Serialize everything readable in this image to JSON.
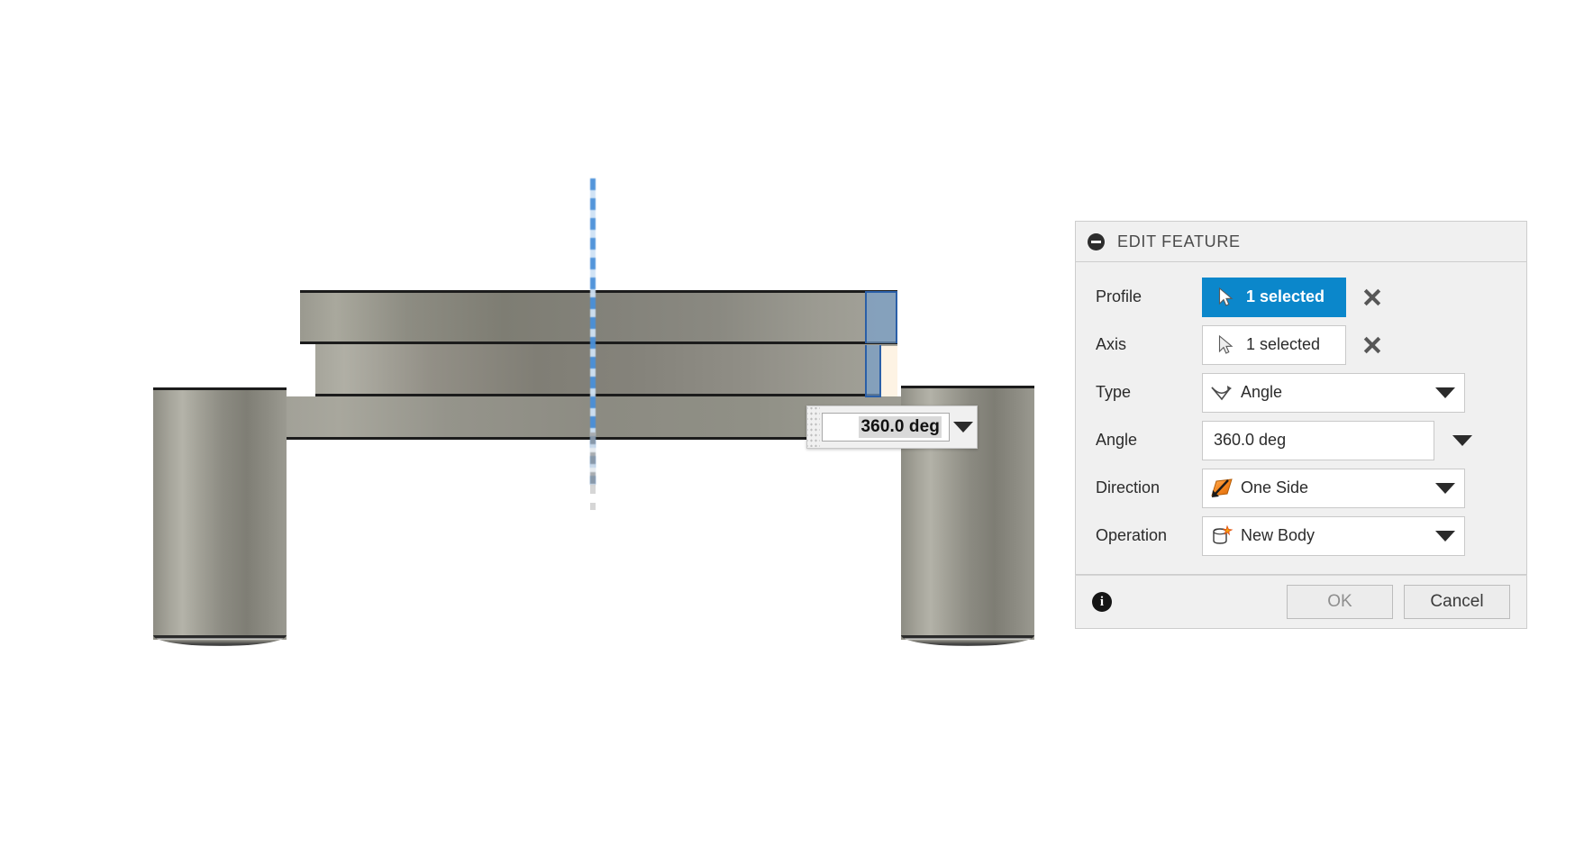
{
  "application": {
    "context": "cad-3d-modeling-viewport"
  },
  "viewport": {
    "model_description": "revolved-metal-part-gray-shaded",
    "axis_label": "revolve-axis-dashed-blue",
    "highlighted_profile": "selected-profile-blue"
  },
  "canvas_input": {
    "name": "angle-value-inline-editor",
    "value": "360.0 deg",
    "dropdown_icon": "chevron-down-icon",
    "grip_icon": "drag-grip-icon"
  },
  "dialog": {
    "title": "EDIT FEATURE",
    "collapse_icon": "collapse-minus-icon",
    "fields": {
      "profile": {
        "label": "Profile",
        "value": "1 selected",
        "icon": "cursor-arrow-icon",
        "clear_icon": "close-x-icon",
        "state": "active"
      },
      "axis": {
        "label": "Axis",
        "value": "1 selected",
        "icon": "cursor-arrow-icon",
        "clear_icon": "close-x-icon",
        "state": "inactive"
      },
      "type": {
        "label": "Type",
        "value": "Angle",
        "icon": "angle-sweep-icon",
        "caret_icon": "chevron-down-icon"
      },
      "angle": {
        "label": "Angle",
        "value": "360.0 deg",
        "caret_icon": "chevron-down-icon"
      },
      "direction": {
        "label": "Direction",
        "value": "One Side",
        "icon": "one-side-direction-icon",
        "caret_icon": "chevron-down-icon"
      },
      "operation": {
        "label": "Operation",
        "value": "New Body",
        "icon": "new-body-icon",
        "caret_icon": "chevron-down-icon"
      }
    },
    "footer": {
      "info_icon": "info-icon",
      "info_glyph": "i",
      "ok_label": "OK",
      "cancel_label": "Cancel"
    }
  },
  "colors": {
    "accent_blue": "#0b87cb",
    "panel_bg": "#f0f0f0",
    "panel_border": "#cdcdcd",
    "field_bg": "#ffffff",
    "field_border": "#c9c9c9",
    "text": "#2b2b2b",
    "title_text": "#4a4a4a",
    "axis_blue": "#4a90d9",
    "profile_highlight": "#2a5fa8",
    "direction_orange": "#f07f1a",
    "ok_disabled_text": "#8e8e8e"
  }
}
